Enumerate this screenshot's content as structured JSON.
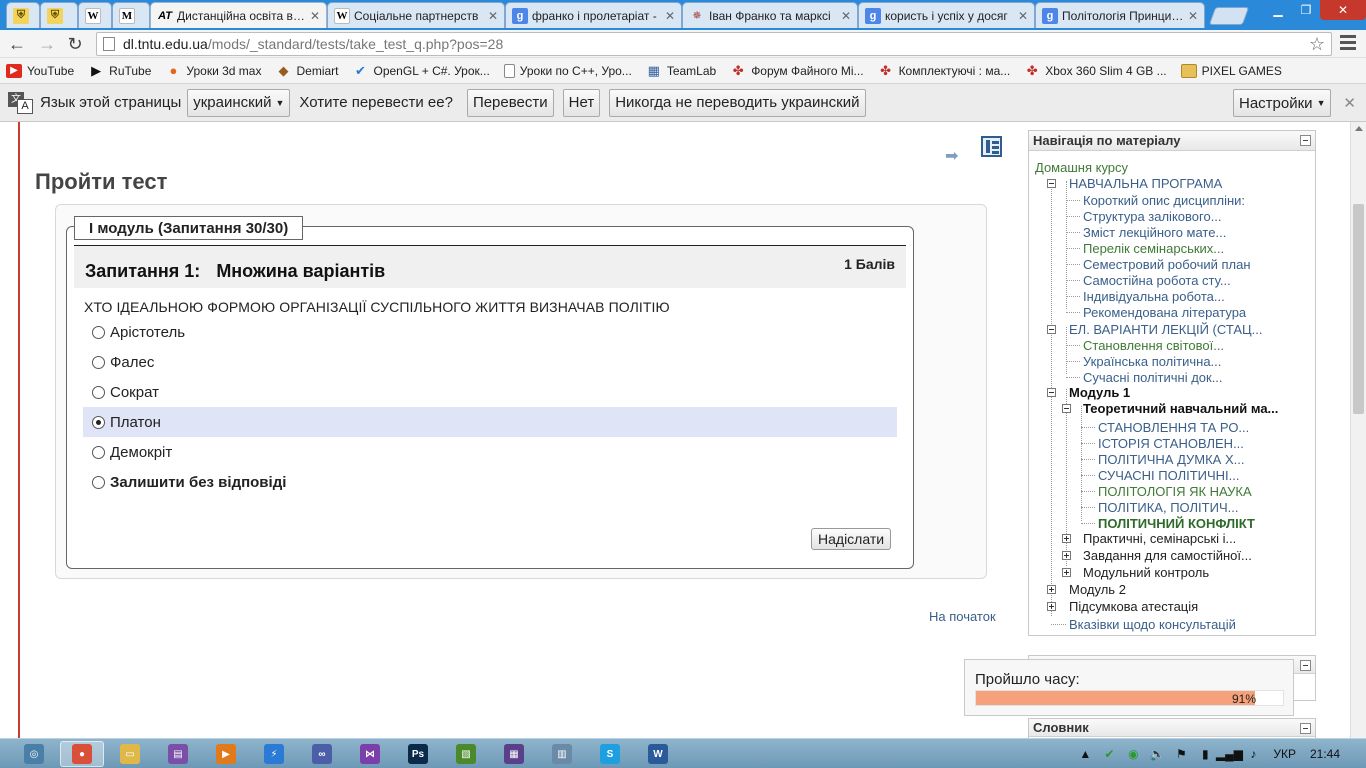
{
  "browser": {
    "tabs": [
      {
        "icon": "shield-icon",
        "title": "",
        "active": false
      },
      {
        "icon": "shield-icon",
        "title": "",
        "active": false
      },
      {
        "icon": "wikipedia-icon",
        "title": "",
        "active": false
      },
      {
        "icon": "moodle-icon",
        "title": "",
        "active": false
      },
      {
        "icon": "at-icon",
        "title": "Дистанційна освіта в ТН",
        "active": true
      },
      {
        "icon": "wikipedia-icon",
        "title": "Соціальне партнерств",
        "active": false
      },
      {
        "icon": "google-icon",
        "title": "франко і пролетаріат -",
        "active": false
      },
      {
        "icon": "star-icon",
        "title": "Іван Франко та марксі",
        "active": false
      },
      {
        "icon": "google-icon",
        "title": "користь і успіх у досяг",
        "active": false
      },
      {
        "icon": "google-icon",
        "title": "Політологія Принципи",
        "active": false
      }
    ],
    "url_host": "dl.tntu.edu.ua",
    "url_path": "/mods/_standard/tests/take_test_q.php?pos=28",
    "bookmarks": [
      {
        "icon": "youtube-icon",
        "label": "YouTube",
        "color": "#e02a20"
      },
      {
        "icon": "rutube-icon",
        "label": "RuTube",
        "color": "#111111"
      },
      {
        "icon": "3d-icon",
        "label": "Уроки 3d max",
        "color": "#e8661c"
      },
      {
        "icon": "demiart-icon",
        "label": "Demiart",
        "color": "#9a5b22"
      },
      {
        "icon": "check-icon",
        "label": "OpenGL + C#. Урок...",
        "color": "#2a7ad6"
      },
      {
        "icon": "page-icon",
        "label": "Уроки по C++, Уро...",
        "color": "#ffffff"
      },
      {
        "icon": "teamlab-icon",
        "label": "TeamLab",
        "color": "#3361a1"
      },
      {
        "icon": "forum-icon",
        "label": "Форум Файного Мі...",
        "color": "#c0302a"
      },
      {
        "icon": "forum-icon",
        "label": "Комплектуючі : ма...",
        "color": "#c0302a"
      },
      {
        "icon": "forum-icon",
        "label": "Xbox 360 Slim 4 GB ...",
        "color": "#c0302a"
      },
      {
        "icon": "folder-icon",
        "label": "PIXEL GAMES",
        "color": "#e8c05a"
      }
    ],
    "translate_bar": {
      "text1": "Язык этой страницы",
      "language": "украинский",
      "question": "Хотите перевести ее?",
      "translate": "Перевести",
      "no": "Нет",
      "never": "Никогда не переводить украинский",
      "settings": "Настройки"
    }
  },
  "page": {
    "title": "Пройти тест",
    "legend": "I модуль (Запитання 30/30)",
    "question_label": "Запитання 1:",
    "question_type": "Множина варіантів",
    "points": "1 Балів",
    "question_text": "ХТО ІДЕАЛЬНОЮ ФОРМОЮ ОРГАНІЗАЦІЇ СУСПІЛЬНОГО ЖИТТЯ ВИЗНАЧАВ ПОЛІТІЮ",
    "answers": [
      {
        "label": "Арістотель",
        "checked": false
      },
      {
        "label": "Фалес",
        "checked": false
      },
      {
        "label": "Сократ",
        "checked": false
      },
      {
        "label": "Платон",
        "checked": true
      },
      {
        "label": "Демокріт",
        "checked": false
      },
      {
        "label": "Залишити без відповіді",
        "checked": false
      }
    ],
    "submit": "Надіслати",
    "to_top": "На початок"
  },
  "nav": {
    "title": "Навігація по матеріалу",
    "home": "Домашня курсу",
    "items": [
      {
        "level": 1,
        "label": "НАВЧАЛЬНА ПРОГРАМА",
        "box": "minus",
        "style": "link"
      },
      {
        "level": 2,
        "label": "Короткий опис дисципліни:",
        "style": "link"
      },
      {
        "level": 2,
        "label": "Структура залікового...",
        "style": "link"
      },
      {
        "level": 2,
        "label": "Зміст лекційного мате...",
        "style": "link"
      },
      {
        "level": 2,
        "label": "Перелік семінарських...",
        "style": "green"
      },
      {
        "level": 2,
        "label": "Семестровий робочий план",
        "style": "link"
      },
      {
        "level": 2,
        "label": "Самостійна робота сту...",
        "style": "link"
      },
      {
        "level": 2,
        "label": "Індивідуальна робота...",
        "style": "link"
      },
      {
        "level": 2,
        "label": "Рекомендована література",
        "style": "link"
      },
      {
        "level": 1,
        "label": "ЕЛ. ВАРІАНТИ ЛЕКЦІЙ (СТАЦ...",
        "box": "minus",
        "style": "link"
      },
      {
        "level": 2,
        "label": "Становлення світової...",
        "style": "green"
      },
      {
        "level": 2,
        "label": "Українська політична...",
        "style": "link"
      },
      {
        "level": 2,
        "label": "Сучасні політичні док...",
        "style": "link"
      },
      {
        "level": 1,
        "label": "Модуль 1",
        "box": "minus",
        "style": "bold"
      },
      {
        "level": 2,
        "label": "Теоретичний навчальний ма...",
        "box": "minus",
        "style": "bold"
      },
      {
        "level": 3,
        "label": "СТАНОВЛЕННЯ ТА РО...",
        "style": "link"
      },
      {
        "level": 3,
        "label": "ІСТОРІЯ СТАНОВЛЕН...",
        "style": "link"
      },
      {
        "level": 3,
        "label": "ПОЛІТИЧНА ДУМКА Х...",
        "style": "link"
      },
      {
        "level": 3,
        "label": "СУЧАСНІ ПОЛІТИЧНІ...",
        "style": "link"
      },
      {
        "level": 3,
        "label": "ПОЛІТОЛОГІЯ ЯК НАУКА",
        "style": "green"
      },
      {
        "level": 3,
        "label": "ПОЛІТИКА, ПОЛІТИЧ...",
        "style": "link"
      },
      {
        "level": 3,
        "label": "ПОЛІТИЧНИЙ КОНФЛІКТ",
        "style": "current"
      },
      {
        "level": 2,
        "label": "Практичні, семінарські і...",
        "box": "plus",
        "style": "dark"
      },
      {
        "level": 2,
        "label": "Завдання для самостійної...",
        "box": "plus",
        "style": "dark"
      },
      {
        "level": 2,
        "label": "Модульний контроль",
        "box": "plus",
        "style": "dark"
      },
      {
        "level": 1,
        "label": "Модуль 2",
        "box": "plus",
        "style": "dark"
      },
      {
        "level": 1,
        "label": "Підсумкова атестація",
        "box": "plus",
        "style": "dark"
      },
      {
        "level": 1,
        "label": "Вказівки щодо консультацій",
        "style": "link"
      }
    ]
  },
  "timer": {
    "label": "Пройшло часу:",
    "percent_label": "91%",
    "progress": 0.91,
    "fill_color": "#f5a17c"
  },
  "glossary": {
    "title": "Словник"
  },
  "taskbar": {
    "apps": [
      {
        "icon": "start-icon",
        "color": "#4a7fa8"
      },
      {
        "icon": "chrome-icon",
        "color": "#d94f3a"
      },
      {
        "icon": "explorer-icon",
        "color": "#e0b84a"
      },
      {
        "icon": "media-icon",
        "color": "#7a4fa8"
      },
      {
        "icon": "player-icon",
        "color": "#e07a1a"
      },
      {
        "icon": "flash-icon",
        "color": "#2a7ad6"
      },
      {
        "icon": "glasses-icon",
        "color": "#4a5fa8"
      },
      {
        "icon": "vs-icon",
        "color": "#7a3fa8"
      },
      {
        "icon": "photoshop-icon",
        "color": "#0a2a4a"
      },
      {
        "icon": "visio-icon",
        "color": "#4a8a2a"
      },
      {
        "icon": "mosaic-icon",
        "color": "#5a3f8a"
      },
      {
        "icon": "calc-icon",
        "color": "#6a8aa8"
      },
      {
        "icon": "skype-icon",
        "color": "#1ea0e0"
      },
      {
        "icon": "word-icon",
        "color": "#2a5a9a"
      }
    ],
    "lang": "УКР",
    "clock": "21:44"
  }
}
